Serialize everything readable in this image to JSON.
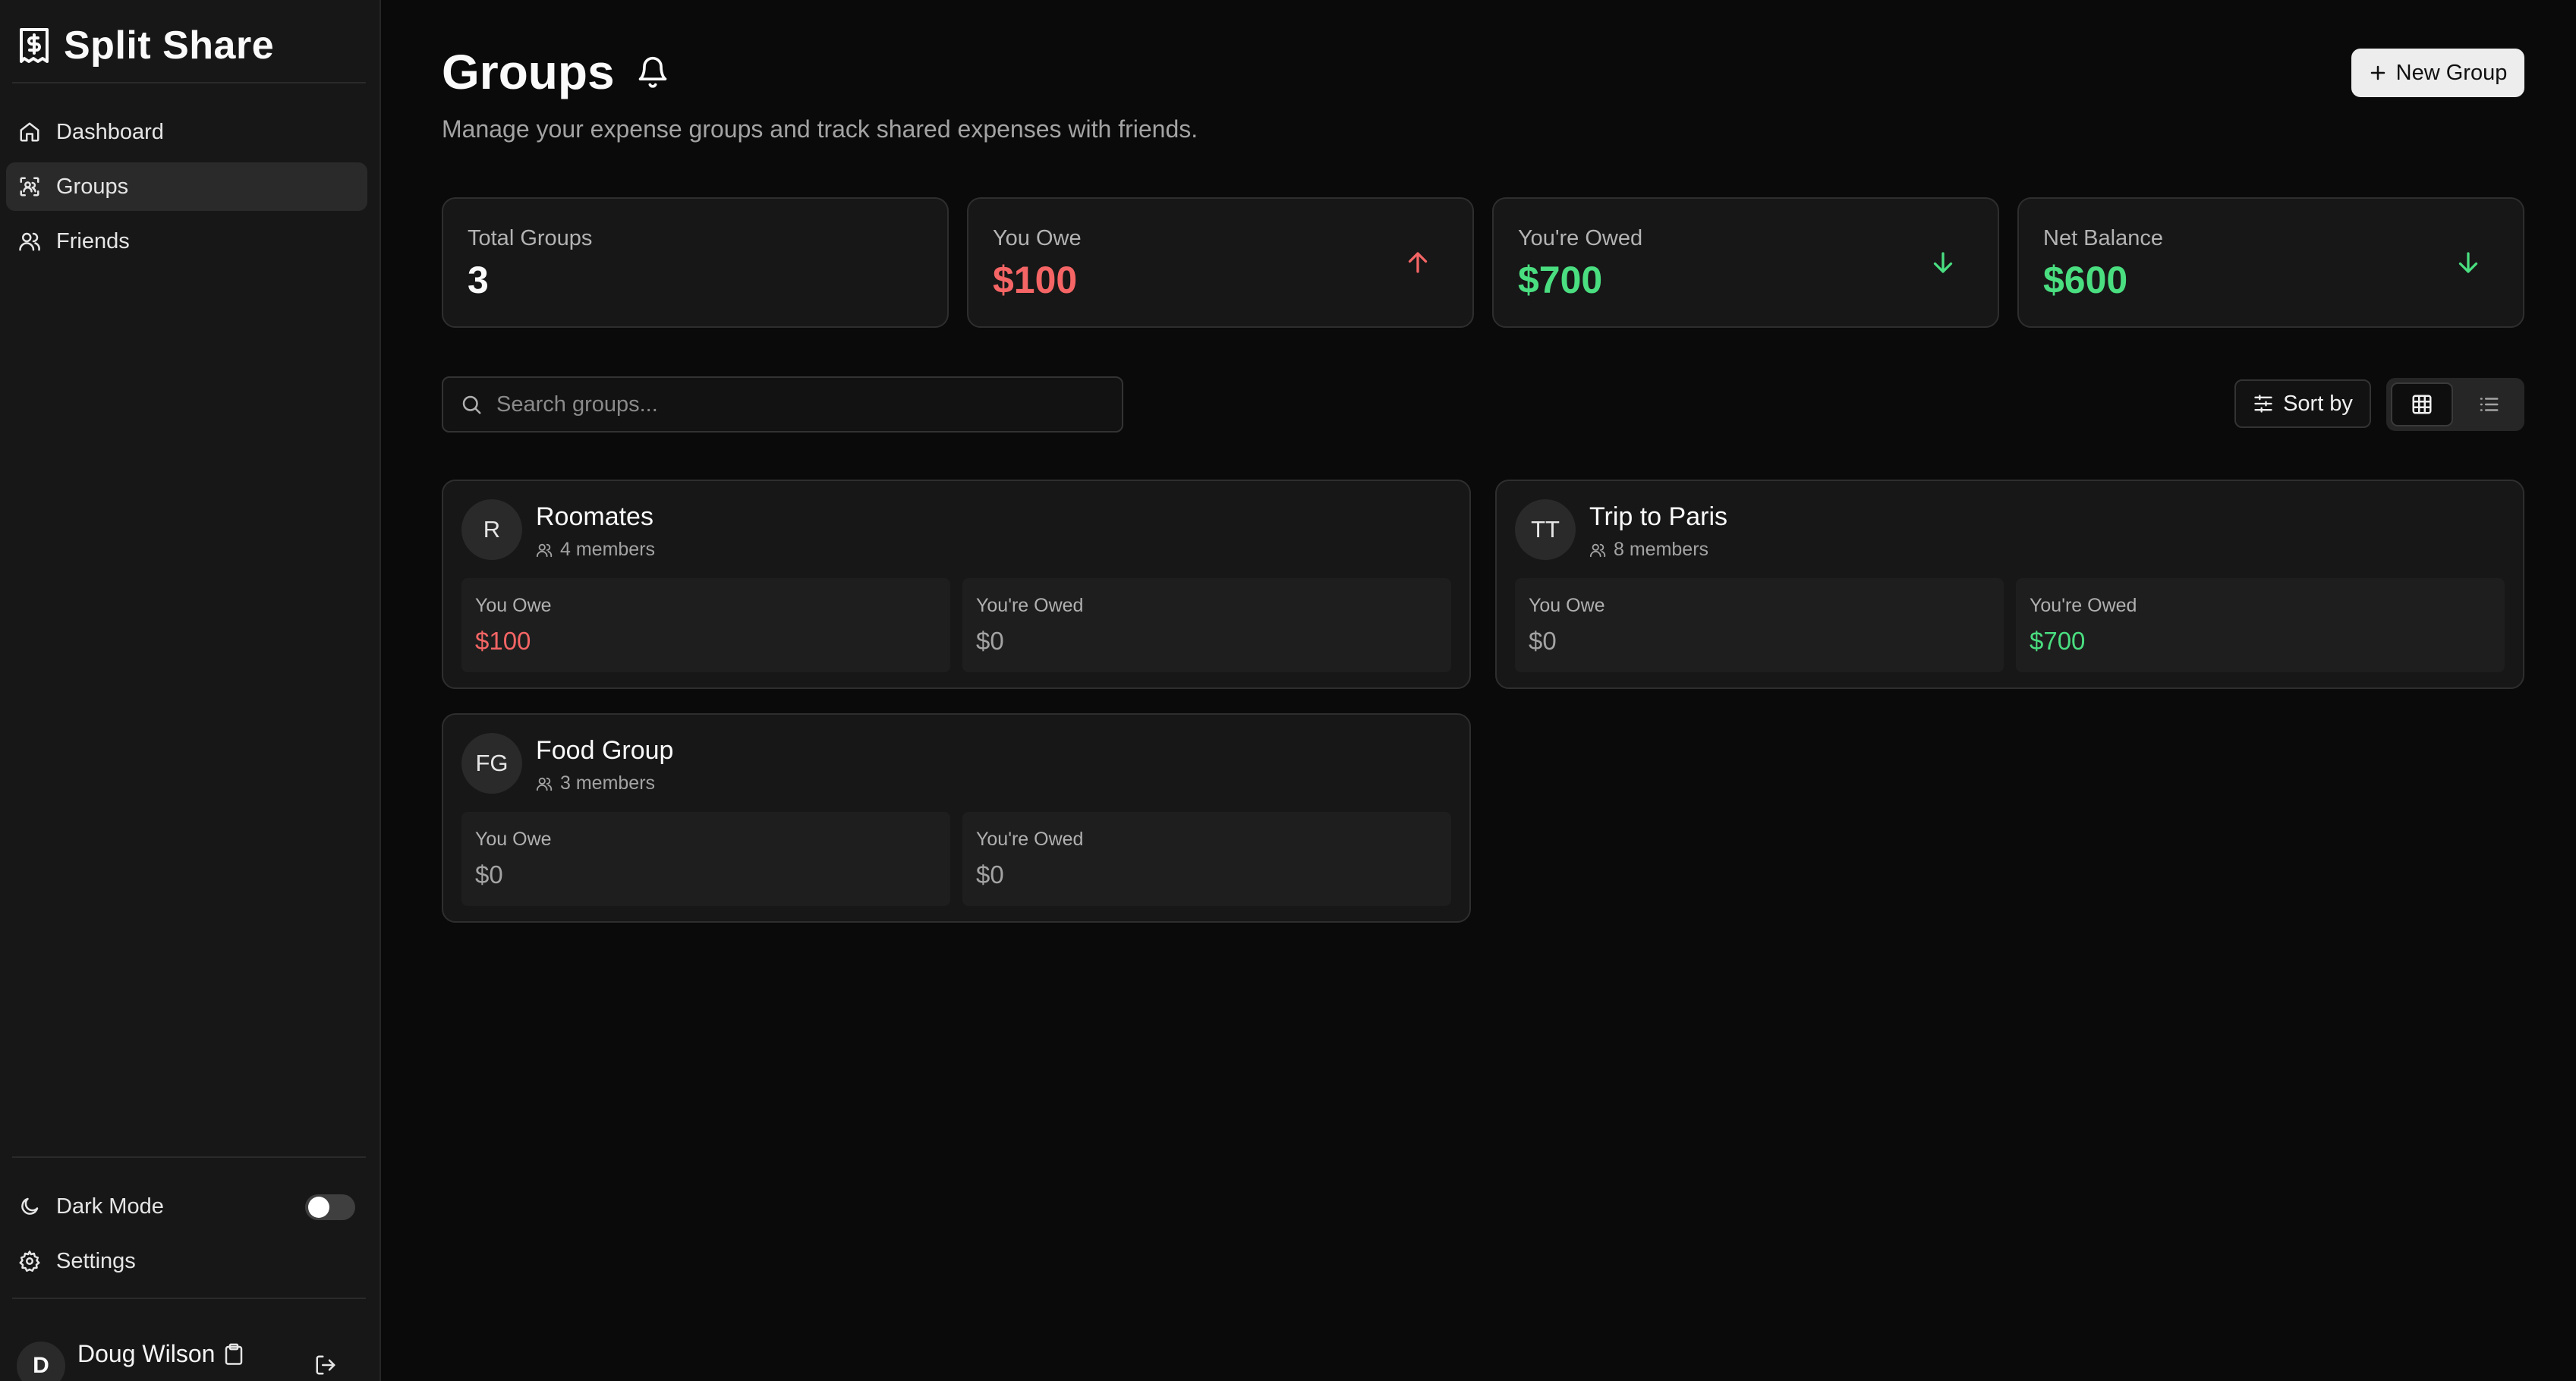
{
  "app": {
    "title": "Split Share"
  },
  "sidebar": {
    "nav": [
      {
        "label": "Dashboard",
        "icon": "home-icon"
      },
      {
        "label": "Groups",
        "icon": "groups-icon",
        "active": true
      },
      {
        "label": "Friends",
        "icon": "users-icon"
      }
    ],
    "dark_mode_label": "Dark Mode",
    "dark_mode_on": false,
    "settings_label": "Settings",
    "user": {
      "initial": "D",
      "name": "Doug Wilson"
    }
  },
  "header": {
    "title": "Groups",
    "subtitle": "Manage your expense groups and track shared expenses with friends.",
    "new_group_label": "New Group"
  },
  "stats": [
    {
      "label": "Total Groups",
      "value": "3"
    },
    {
      "label": "You Owe",
      "value": "$100",
      "color": "#f56565",
      "arrow": "up"
    },
    {
      "label": "You're Owed",
      "value": "$700",
      "color": "#4ade80",
      "arrow": "down"
    },
    {
      "label": "Net Balance",
      "value": "$600",
      "color": "#4ade80",
      "arrow": "down"
    }
  ],
  "toolbar": {
    "search_placeholder": "Search groups...",
    "sort_label": "Sort by",
    "view_mode": "grid"
  },
  "groups": [
    {
      "initials": "R",
      "name": "Roomates",
      "members": "4 members",
      "owe_label": "You Owe",
      "owe_value": "$100",
      "owed_label": "You're Owed",
      "owed_value": "$0"
    },
    {
      "initials": "TT",
      "name": "Trip to Paris",
      "members": "8 members",
      "owe_label": "You Owe",
      "owe_value": "$0",
      "owed_label": "You're Owed",
      "owed_value": "$700"
    },
    {
      "initials": "FG",
      "name": "Food Group",
      "members": "3 members",
      "owe_label": "You Owe",
      "owe_value": "$0",
      "owed_label": "You're Owed",
      "owed_value": "$0"
    }
  ],
  "colors": {
    "negative": "#f56565",
    "positive": "#4ade80"
  }
}
